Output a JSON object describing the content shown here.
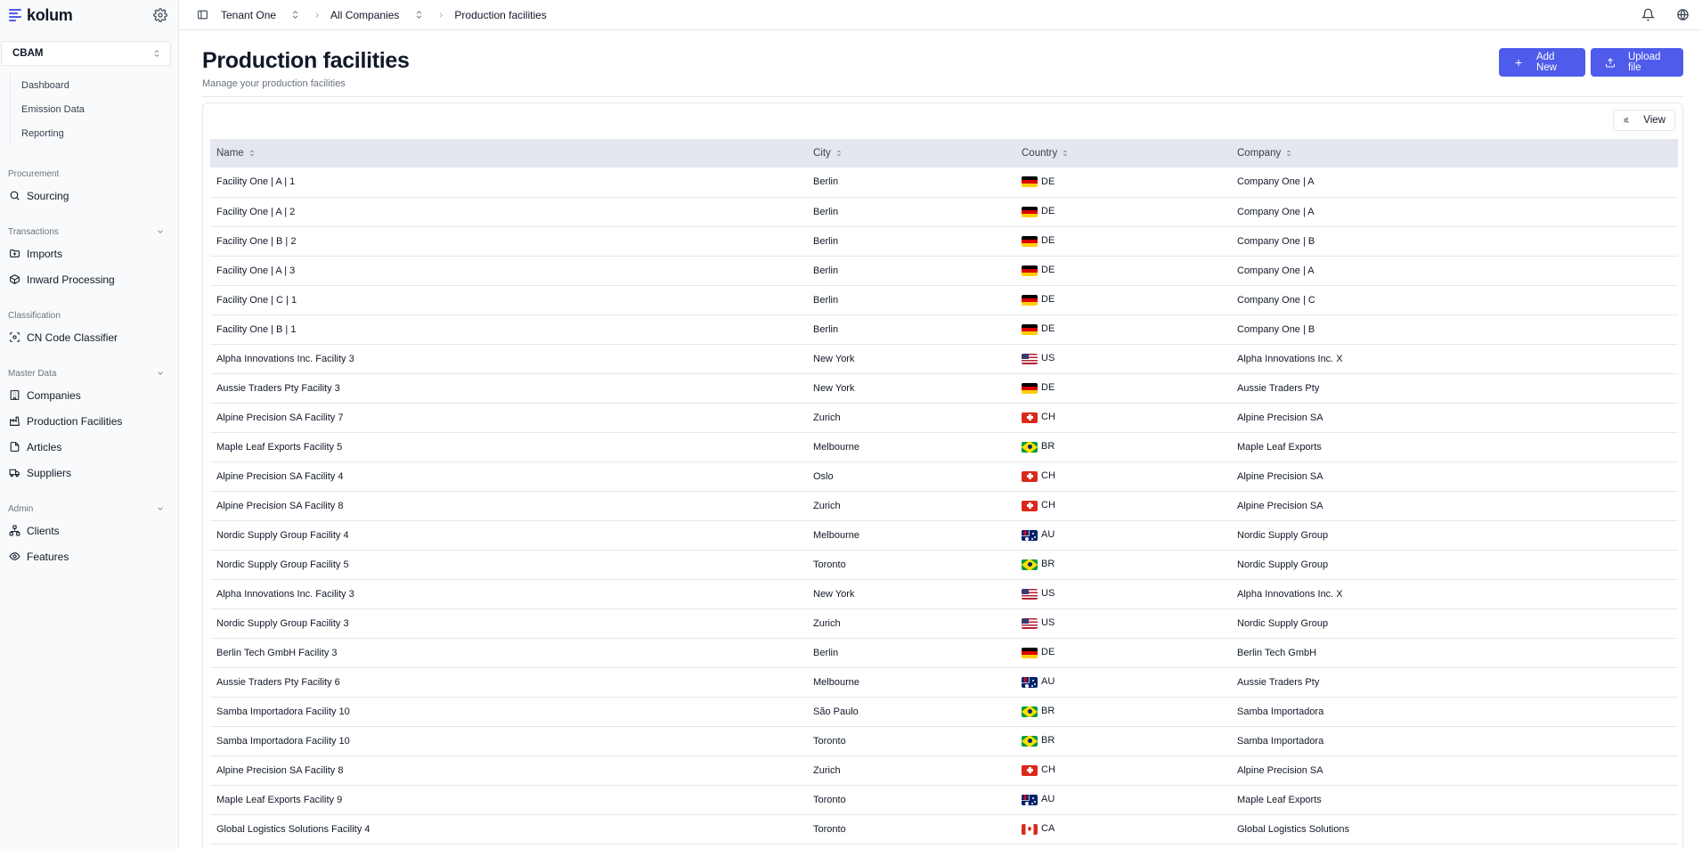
{
  "brand": {
    "name": "kolum"
  },
  "sidebar": {
    "module": "CBAM",
    "submenu": [
      "Dashboard",
      "Emission Data",
      "Reporting"
    ],
    "sections": {
      "procurement": {
        "label": "Procurement",
        "items": [
          {
            "label": "Sourcing",
            "icon": "search-icon"
          }
        ]
      },
      "transactions": {
        "label": "Transactions",
        "items": [
          {
            "label": "Imports",
            "icon": "folder-icon"
          },
          {
            "label": "Inward Processing",
            "icon": "package-icon"
          }
        ]
      },
      "classification": {
        "label": "Classification",
        "items": [
          {
            "label": "CN Code Classifier",
            "icon": "scan-icon"
          }
        ]
      },
      "master_data": {
        "label": "Master Data",
        "items": [
          {
            "label": "Companies",
            "icon": "building-icon"
          },
          {
            "label": "Production Facilities",
            "icon": "factory-icon"
          },
          {
            "label": "Articles",
            "icon": "file-icon"
          },
          {
            "label": "Suppliers",
            "icon": "truck-icon"
          }
        ]
      },
      "admin": {
        "label": "Admin",
        "items": [
          {
            "label": "Clients",
            "icon": "network-icon"
          },
          {
            "label": "Features",
            "icon": "eye-icon"
          }
        ]
      }
    }
  },
  "topbar": {
    "tenant": "Tenant One",
    "company": "All Companies",
    "current": "Production facilities"
  },
  "page": {
    "title": "Production facilities",
    "subtitle": "Manage your production facilities",
    "add_label": "Add New",
    "upload_label": "Upload file",
    "view_label": "View"
  },
  "table": {
    "columns": [
      "Name",
      "City",
      "Country",
      "Company"
    ],
    "rows": [
      {
        "name": "Facility One | A | 1",
        "city": "Berlin",
        "country": "DE",
        "company": "Company One | A"
      },
      {
        "name": "Facility One | A | 2",
        "city": "Berlin",
        "country": "DE",
        "company": "Company One | A"
      },
      {
        "name": "Facility One | B | 2",
        "city": "Berlin",
        "country": "DE",
        "company": "Company One | B"
      },
      {
        "name": "Facility One | A | 3",
        "city": "Berlin",
        "country": "DE",
        "company": "Company One | A"
      },
      {
        "name": "Facility One | C | 1",
        "city": "Berlin",
        "country": "DE",
        "company": "Company One | C"
      },
      {
        "name": "Facility One | B | 1",
        "city": "Berlin",
        "country": "DE",
        "company": "Company One | B"
      },
      {
        "name": "Alpha Innovations Inc. Facility 3",
        "city": "New York",
        "country": "US",
        "company": "Alpha Innovations Inc. X"
      },
      {
        "name": "Aussie Traders Pty Facility 3",
        "city": "New York",
        "country": "DE",
        "company": "Aussie Traders Pty"
      },
      {
        "name": "Alpine Precision SA Facility 7",
        "city": "Zurich",
        "country": "CH",
        "company": "Alpine Precision SA"
      },
      {
        "name": "Maple Leaf Exports Facility 5",
        "city": "Melbourne",
        "country": "BR",
        "company": "Maple Leaf Exports"
      },
      {
        "name": "Alpine Precision SA Facility 4",
        "city": "Oslo",
        "country": "CH",
        "company": "Alpine Precision SA"
      },
      {
        "name": "Alpine Precision SA Facility 8",
        "city": "Zurich",
        "country": "CH",
        "company": "Alpine Precision SA"
      },
      {
        "name": "Nordic Supply Group Facility 4",
        "city": "Melbourne",
        "country": "AU",
        "company": "Nordic Supply Group"
      },
      {
        "name": "Nordic Supply Group Facility 5",
        "city": "Toronto",
        "country": "BR",
        "company": "Nordic Supply Group"
      },
      {
        "name": "Alpha Innovations Inc. Facility 3",
        "city": "New York",
        "country": "US",
        "company": "Alpha Innovations Inc. X"
      },
      {
        "name": "Nordic Supply Group Facility 3",
        "city": "Zurich",
        "country": "US",
        "company": "Nordic Supply Group"
      },
      {
        "name": "Berlin Tech GmbH Facility 3",
        "city": "Berlin",
        "country": "DE",
        "company": "Berlin Tech GmbH"
      },
      {
        "name": "Aussie Traders Pty Facility 6",
        "city": "Melbourne",
        "country": "AU",
        "company": "Aussie Traders Pty"
      },
      {
        "name": "Samba Importadora Facility 10",
        "city": "São Paulo",
        "country": "BR",
        "company": "Samba Importadora"
      },
      {
        "name": "Samba Importadora Facility 10",
        "city": "Toronto",
        "country": "BR",
        "company": "Samba Importadora"
      },
      {
        "name": "Alpine Precision SA Facility 8",
        "city": "Zurich",
        "country": "CH",
        "company": "Alpine Precision SA"
      },
      {
        "name": "Maple Leaf Exports Facility 9",
        "city": "Toronto",
        "country": "AU",
        "company": "Maple Leaf Exports"
      },
      {
        "name": "Global Logistics Solutions Facility 4",
        "city": "Toronto",
        "country": "CA",
        "company": "Global Logistics Solutions"
      }
    ]
  },
  "colors": {
    "accent": "#4f5bea",
    "header_bg": "#e5e7ef",
    "border": "#e5e7eb"
  }
}
